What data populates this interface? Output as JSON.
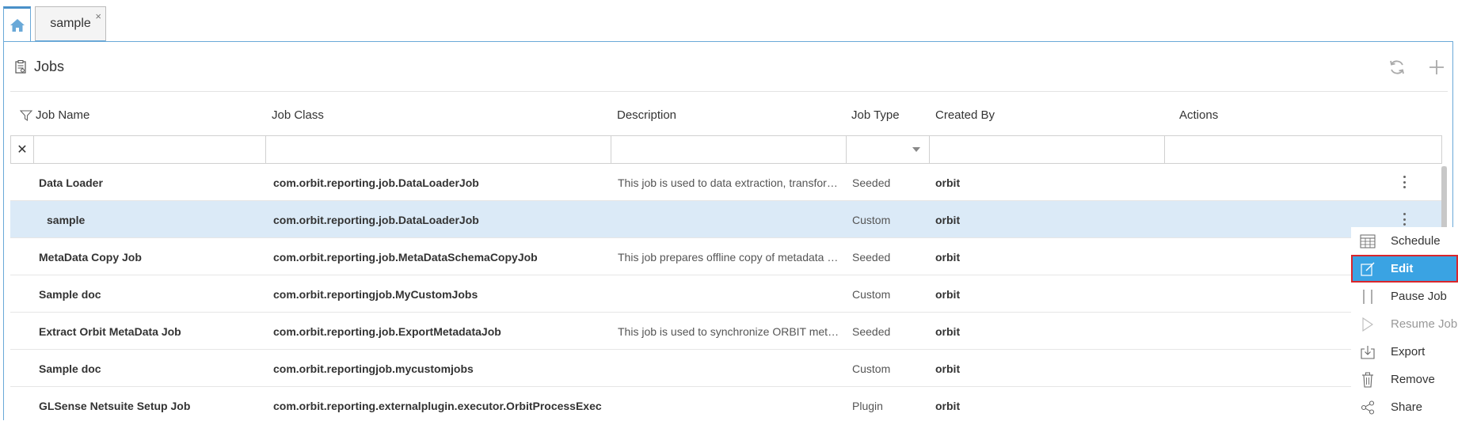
{
  "tabs": [
    {
      "icon": "home-icon"
    },
    {
      "label": "sample",
      "close": "×"
    }
  ],
  "panel": {
    "title": "Jobs",
    "title_icon": "clipboard-icon",
    "actions": [
      "refresh-icon",
      "add-icon"
    ]
  },
  "columns": {
    "job_name": "Job Name",
    "job_class": "Job Class",
    "description": "Description",
    "job_type": "Job Type",
    "created_by": "Created By",
    "actions": "Actions"
  },
  "filter": {
    "clear": "✕"
  },
  "rows": [
    {
      "name": "Data Loader",
      "class": "com.orbit.reporting.job.DataLoaderJob",
      "description": "This job is used to data extraction, transform a…",
      "type": "Seeded",
      "created_by": "orbit"
    },
    {
      "name": "sample",
      "class": "com.orbit.reporting.job.DataLoaderJob",
      "description": "",
      "type": "Custom",
      "created_by": "orbit"
    },
    {
      "name": "MetaData Copy Job",
      "class": "com.orbit.reporting.job.MetaDataSchemaCopyJob",
      "description": "This job prepares offline copy of metadata sche…",
      "type": "Seeded",
      "created_by": "orbit"
    },
    {
      "name": "Sample doc",
      "class": "com.orbit.reportingjob.MyCustomJobs",
      "description": "",
      "type": "Custom",
      "created_by": "orbit"
    },
    {
      "name": "Extract Orbit MetaData Job",
      "class": "com.orbit.reporting.job.ExportMetadataJob",
      "description": "This job is used to synchronize ORBIT meta sta…",
      "type": "Seeded",
      "created_by": "orbit"
    },
    {
      "name": "Sample doc",
      "class": "com.orbit.reportingjob.mycustomjobs",
      "description": "",
      "type": "Custom",
      "created_by": "orbit"
    },
    {
      "name": "GLSense Netsuite Setup Job",
      "class": "com.orbit.reporting.externalplugin.executor.OrbitProcessExec",
      "description": "",
      "type": "Plugin",
      "created_by": "orbit"
    }
  ],
  "context_menu": [
    {
      "label": "Schedule",
      "icon": "calendar-icon"
    },
    {
      "label": "Edit",
      "icon": "edit-icon"
    },
    {
      "label": "Pause Job",
      "icon": "pause-icon"
    },
    {
      "label": "Resume Job",
      "icon": "play-icon"
    },
    {
      "label": "Export",
      "icon": "export-icon"
    },
    {
      "label": "Remove",
      "icon": "trash-icon"
    },
    {
      "label": "Share",
      "icon": "share-icon"
    }
  ],
  "colors": {
    "accent": "#3aa3e3",
    "selected_row": "#dbeaf7",
    "highlight_border": "#d9262b",
    "tab_border": "#6aa9d8"
  }
}
